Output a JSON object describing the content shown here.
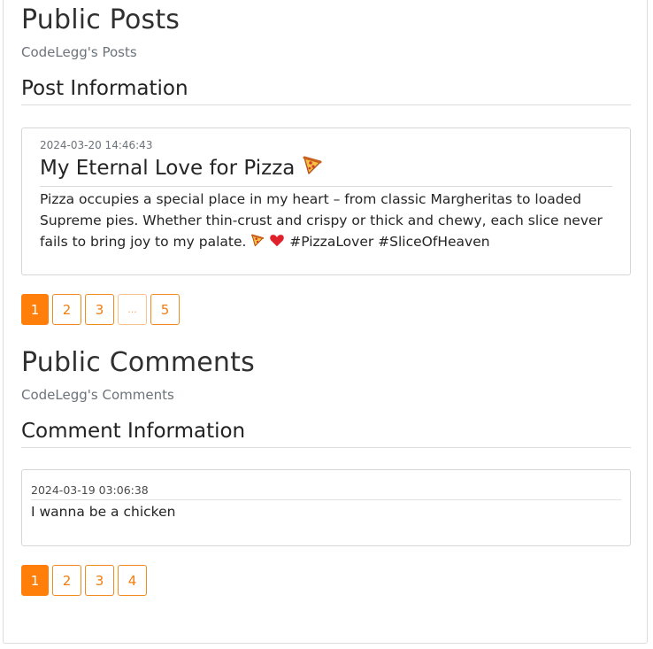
{
  "posts_section": {
    "title": "Public Posts",
    "subtitle": "CodeLegg's Posts",
    "info_title": "Post Information",
    "post": {
      "date": "2024-03-20 14:46:43",
      "title": "My Eternal Love for Pizza",
      "title_icon": "pizza-icon",
      "body": "Pizza occupies a special place in my heart – from classic Margheritas to loaded Supreme pies. Whether thin-crust and crispy or thick and chewy, each slice never fails to bring joy to my palate.",
      "body_icons": [
        "pizza-icon",
        "heart-icon"
      ],
      "tags": "#PizzaLover #SliceOfHeaven"
    },
    "pagination": [
      {
        "label": "1",
        "active": true
      },
      {
        "label": "2",
        "active": false
      },
      {
        "label": "3",
        "active": false
      },
      {
        "label": "...",
        "active": false
      },
      {
        "label": "5",
        "active": false
      }
    ]
  },
  "comments_section": {
    "title": "Public Comments",
    "subtitle": "CodeLegg's Comments",
    "info_title": "Comment Information",
    "comment": {
      "date": "2024-03-19 03:06:38",
      "text": "I wanna be a chicken"
    },
    "pagination": [
      {
        "label": "1",
        "active": true
      },
      {
        "label": "2",
        "active": false
      },
      {
        "label": "3",
        "active": false
      },
      {
        "label": "4",
        "active": false
      }
    ]
  },
  "colors": {
    "accent": "#ff7f0a",
    "border": "#dcdcdc",
    "muted_text": "#6c737a"
  }
}
